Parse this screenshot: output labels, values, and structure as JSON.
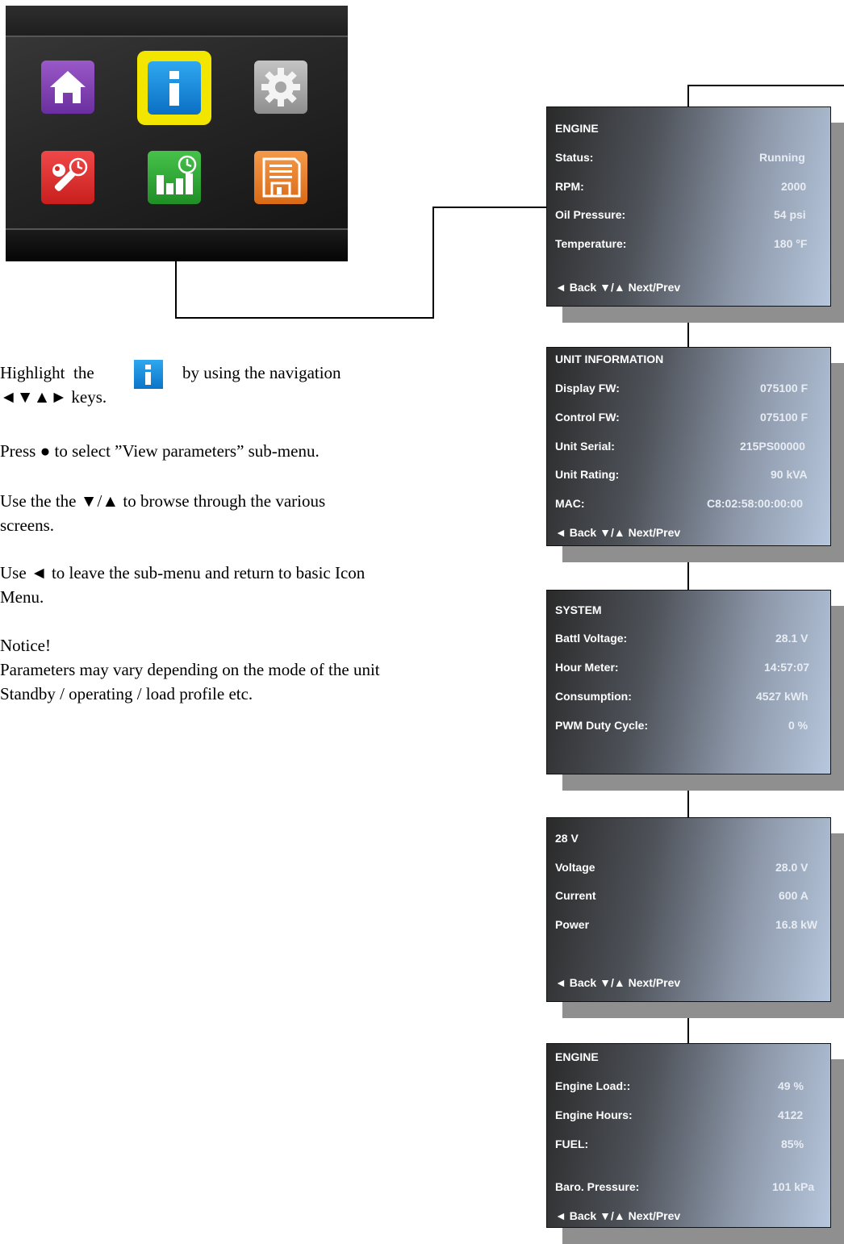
{
  "instructions": {
    "line1a": "Highlight  the",
    "line1b": "by using the navigation",
    "line2": "◄▼▲► keys.",
    "line3": "Press ● to select ”View parameters” sub-menu.",
    "line4": "Use the the ▼/▲ to browse through the various",
    "line5": "screens.",
    "line6": "Use ◄ to leave the sub-menu and return to basic Icon",
    "line7": "Menu.",
    "line8": "Notice!",
    "line9": "Parameters may vary depending on the mode of the unit",
    "line10": "Standby / operating / load profile etc."
  },
  "footer": "◄ Back  ▼/▲ Next/Prev",
  "screens": [
    {
      "title": "ENGINE",
      "rows": [
        {
          "label": "Status:",
          "value": "Running"
        },
        {
          "label": "RPM:",
          "value": "2000"
        },
        {
          "label": "Oil Pressure:",
          "value": "54 psi"
        },
        {
          "label": "Temperature:",
          "value": "180 °F"
        }
      ]
    },
    {
      "title": "UNIT INFORMATION",
      "rows": [
        {
          "label": "Display FW:",
          "value": "075100 F"
        },
        {
          "label": "Control FW:",
          "value": "075100 F"
        },
        {
          "label": "Unit Serial:",
          "value": "215PS00000"
        },
        {
          "label": "Unit Rating:",
          "value": "90 kVA"
        },
        {
          "label": "MAC:",
          "value": "C8:02:58:00:00:00"
        }
      ]
    },
    {
      "title": "SYSTEM",
      "rows": [
        {
          "label": "Battl Voltage:",
          "value": "28.1 V"
        },
        {
          "label": "Hour Meter:",
          "value": "14:57:07"
        },
        {
          "label": "Consumption:",
          "value": "4527 kWh"
        },
        {
          "label": "PWM Duty Cycle:",
          "value": "0 %"
        }
      ]
    },
    {
      "title": "28 V",
      "rows": [
        {
          "label": "Voltage",
          "value": "28.0 V"
        },
        {
          "label": "Current",
          "value": "600 A"
        },
        {
          "label": "Power",
          "value": "16.8 kW"
        }
      ]
    },
    {
      "title": "ENGINE",
      "rows": [
        {
          "label": "Engine Load::",
          "value": "49 %"
        },
        {
          "label": "Engine Hours:",
          "value": "4122"
        },
        {
          "label": "FUEL:",
          "value": "85%"
        },
        {
          "label": "Baro. Pressure:",
          "value": "101 kPa"
        }
      ]
    }
  ]
}
